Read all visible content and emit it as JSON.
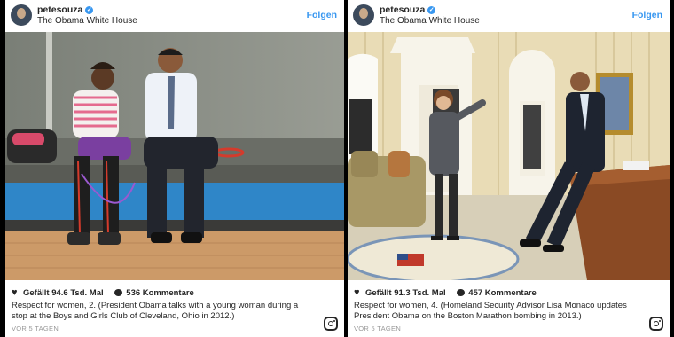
{
  "posts": [
    {
      "username": "petesouza",
      "location": "The Obama White House",
      "follow_label": "Folgen",
      "likes": "Gefällt 94.6 Tsd. Mal",
      "comments": "536 Kommentare",
      "caption": "Respect for women, 2. (President Obama talks with a young woman during a stop at the Boys and Girls Club of Cleveland, Ohio in 2012.)",
      "time_ago": "VOR 5 TAGEN"
    },
    {
      "username": "petesouza",
      "location": "The Obama White House",
      "follow_label": "Folgen",
      "likes": "Gefällt 91.3 Tsd. Mal",
      "comments": "457 Kommentare",
      "caption": "Respect for women, 4. (Homeland Security Advisor Lisa Monaco updates President Obama on the Boston Marathon bombing in 2013.)",
      "time_ago": "VOR 5 TAGEN"
    }
  ],
  "icons": {
    "verified": "verified-badge-icon",
    "like": "heart-icon",
    "comment": "comment-bubble-icon",
    "brand": "instagram-icon"
  },
  "colors": {
    "accent": "#3897f0",
    "text": "#262626",
    "muted": "#999999"
  }
}
